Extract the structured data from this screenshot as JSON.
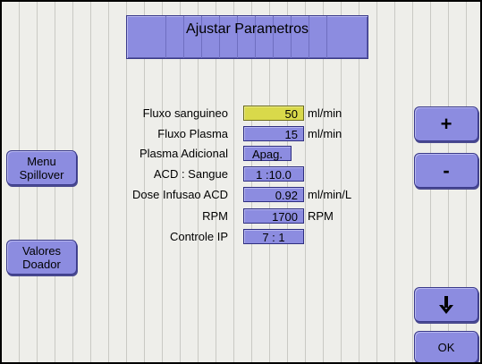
{
  "header": {
    "title": "Ajustar Parametros"
  },
  "left_buttons": {
    "spillover": [
      "Menu",
      "Spillover"
    ],
    "donor": [
      "Valores",
      "Doador"
    ]
  },
  "right_buttons": {
    "increment": "+",
    "decrement": "-",
    "down_icon": "down-arrow-icon",
    "ok": "OK"
  },
  "params": [
    {
      "label": "Fluxo sanguineo",
      "value": "50",
      "unit": "ml/min",
      "selected": true
    },
    {
      "label": "Fluxo Plasma",
      "value": "15",
      "unit": "ml/min"
    },
    {
      "label": "Plasma Adicional",
      "value": "Apag."
    },
    {
      "label": "ACD : Sangue",
      "value": "1 :10.0"
    },
    {
      "label": "Dose Infusao ACD",
      "value": "0.92",
      "unit": "ml/min/L"
    },
    {
      "label": "RPM",
      "value": "1700",
      "unit": "RPM"
    },
    {
      "label": "Controle IP",
      "value": "7 : 1"
    }
  ],
  "colors": {
    "button": "#8c8ce0",
    "selected": "#d9d94a",
    "background": "#eeeeea"
  }
}
